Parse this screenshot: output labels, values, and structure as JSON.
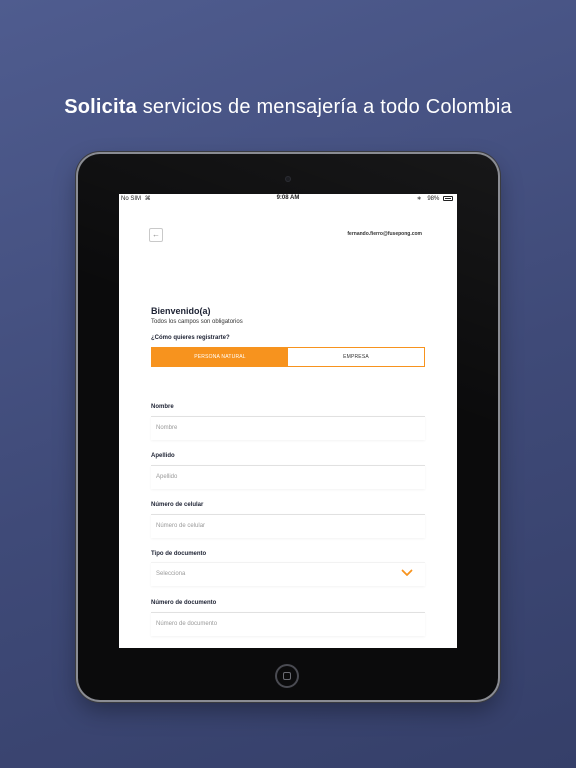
{
  "headline": {
    "bold": "Solicita",
    "rest": " servicios de mensajería a todo Colombia"
  },
  "statusbar": {
    "carrier": "No SIM",
    "time": "9:08 AM",
    "battery": "98%"
  },
  "header": {
    "back_symbol": "←",
    "email": "fernando.fierro@fusepong.com"
  },
  "form": {
    "title": "Bienvenido(a)",
    "subtitle": "Todos los campos son obligatorios",
    "question": "¿Cómo quieres registrarte?",
    "segments": [
      "PERSONA NATURAL",
      "EMPRESA"
    ],
    "fields": {
      "nombre": {
        "label": "Nombre",
        "placeholder": "Nombre"
      },
      "apellido": {
        "label": "Apellido",
        "placeholder": "Apellido"
      },
      "celular": {
        "label": "Número de celular",
        "placeholder": "Número de celular"
      },
      "tipo_documento": {
        "label": "Tipo de documento",
        "value": "Selecciona"
      },
      "numero_documento": {
        "label": "Número de documento",
        "placeholder": "Número de documento"
      }
    }
  },
  "colors": {
    "accent": "#f7931e",
    "background": "#46527f",
    "device": "#0b0b0c"
  },
  "icons": {
    "back": "arrow-left-icon",
    "select": "chevron-down-icon"
  }
}
